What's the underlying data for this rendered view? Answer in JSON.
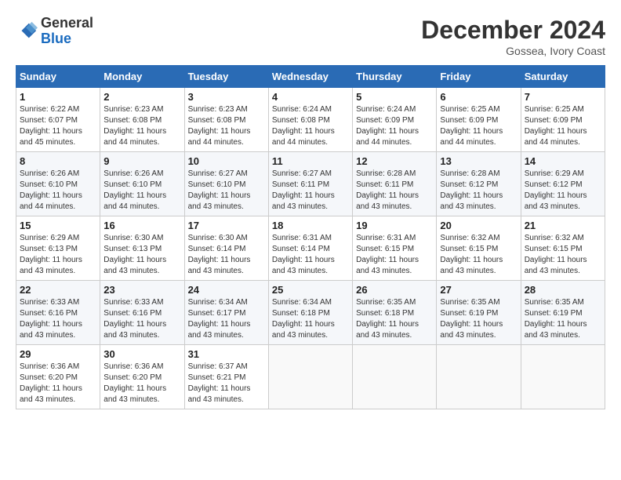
{
  "logo": {
    "general": "General",
    "blue": "Blue"
  },
  "header": {
    "month": "December 2024",
    "location": "Gossea, Ivory Coast"
  },
  "weekdays": [
    "Sunday",
    "Monday",
    "Tuesday",
    "Wednesday",
    "Thursday",
    "Friday",
    "Saturday"
  ],
  "weeks": [
    [
      {
        "day": "1",
        "detail": "Sunrise: 6:22 AM\nSunset: 6:07 PM\nDaylight: 11 hours\nand 45 minutes."
      },
      {
        "day": "2",
        "detail": "Sunrise: 6:23 AM\nSunset: 6:08 PM\nDaylight: 11 hours\nand 44 minutes."
      },
      {
        "day": "3",
        "detail": "Sunrise: 6:23 AM\nSunset: 6:08 PM\nDaylight: 11 hours\nand 44 minutes."
      },
      {
        "day": "4",
        "detail": "Sunrise: 6:24 AM\nSunset: 6:08 PM\nDaylight: 11 hours\nand 44 minutes."
      },
      {
        "day": "5",
        "detail": "Sunrise: 6:24 AM\nSunset: 6:09 PM\nDaylight: 11 hours\nand 44 minutes."
      },
      {
        "day": "6",
        "detail": "Sunrise: 6:25 AM\nSunset: 6:09 PM\nDaylight: 11 hours\nand 44 minutes."
      },
      {
        "day": "7",
        "detail": "Sunrise: 6:25 AM\nSunset: 6:09 PM\nDaylight: 11 hours\nand 44 minutes."
      }
    ],
    [
      {
        "day": "8",
        "detail": "Sunrise: 6:26 AM\nSunset: 6:10 PM\nDaylight: 11 hours\nand 44 minutes."
      },
      {
        "day": "9",
        "detail": "Sunrise: 6:26 AM\nSunset: 6:10 PM\nDaylight: 11 hours\nand 44 minutes."
      },
      {
        "day": "10",
        "detail": "Sunrise: 6:27 AM\nSunset: 6:10 PM\nDaylight: 11 hours\nand 43 minutes."
      },
      {
        "day": "11",
        "detail": "Sunrise: 6:27 AM\nSunset: 6:11 PM\nDaylight: 11 hours\nand 43 minutes."
      },
      {
        "day": "12",
        "detail": "Sunrise: 6:28 AM\nSunset: 6:11 PM\nDaylight: 11 hours\nand 43 minutes."
      },
      {
        "day": "13",
        "detail": "Sunrise: 6:28 AM\nSunset: 6:12 PM\nDaylight: 11 hours\nand 43 minutes."
      },
      {
        "day": "14",
        "detail": "Sunrise: 6:29 AM\nSunset: 6:12 PM\nDaylight: 11 hours\nand 43 minutes."
      }
    ],
    [
      {
        "day": "15",
        "detail": "Sunrise: 6:29 AM\nSunset: 6:13 PM\nDaylight: 11 hours\nand 43 minutes."
      },
      {
        "day": "16",
        "detail": "Sunrise: 6:30 AM\nSunset: 6:13 PM\nDaylight: 11 hours\nand 43 minutes."
      },
      {
        "day": "17",
        "detail": "Sunrise: 6:30 AM\nSunset: 6:14 PM\nDaylight: 11 hours\nand 43 minutes."
      },
      {
        "day": "18",
        "detail": "Sunrise: 6:31 AM\nSunset: 6:14 PM\nDaylight: 11 hours\nand 43 minutes."
      },
      {
        "day": "19",
        "detail": "Sunrise: 6:31 AM\nSunset: 6:15 PM\nDaylight: 11 hours\nand 43 minutes."
      },
      {
        "day": "20",
        "detail": "Sunrise: 6:32 AM\nSunset: 6:15 PM\nDaylight: 11 hours\nand 43 minutes."
      },
      {
        "day": "21",
        "detail": "Sunrise: 6:32 AM\nSunset: 6:15 PM\nDaylight: 11 hours\nand 43 minutes."
      }
    ],
    [
      {
        "day": "22",
        "detail": "Sunrise: 6:33 AM\nSunset: 6:16 PM\nDaylight: 11 hours\nand 43 minutes."
      },
      {
        "day": "23",
        "detail": "Sunrise: 6:33 AM\nSunset: 6:16 PM\nDaylight: 11 hours\nand 43 minutes."
      },
      {
        "day": "24",
        "detail": "Sunrise: 6:34 AM\nSunset: 6:17 PM\nDaylight: 11 hours\nand 43 minutes."
      },
      {
        "day": "25",
        "detail": "Sunrise: 6:34 AM\nSunset: 6:18 PM\nDaylight: 11 hours\nand 43 minutes."
      },
      {
        "day": "26",
        "detail": "Sunrise: 6:35 AM\nSunset: 6:18 PM\nDaylight: 11 hours\nand 43 minutes."
      },
      {
        "day": "27",
        "detail": "Sunrise: 6:35 AM\nSunset: 6:19 PM\nDaylight: 11 hours\nand 43 minutes."
      },
      {
        "day": "28",
        "detail": "Sunrise: 6:35 AM\nSunset: 6:19 PM\nDaylight: 11 hours\nand 43 minutes."
      }
    ],
    [
      {
        "day": "29",
        "detail": "Sunrise: 6:36 AM\nSunset: 6:20 PM\nDaylight: 11 hours\nand 43 minutes."
      },
      {
        "day": "30",
        "detail": "Sunrise: 6:36 AM\nSunset: 6:20 PM\nDaylight: 11 hours\nand 43 minutes."
      },
      {
        "day": "31",
        "detail": "Sunrise: 6:37 AM\nSunset: 6:21 PM\nDaylight: 11 hours\nand 43 minutes."
      },
      null,
      null,
      null,
      null
    ]
  ]
}
